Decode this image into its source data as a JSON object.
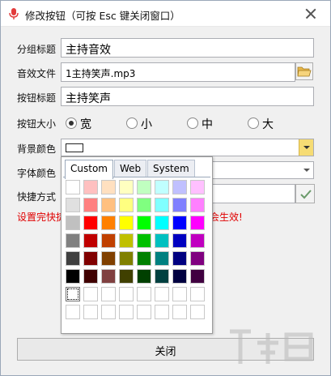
{
  "window": {
    "title": "修改按钮（可按 Esc 键关闭窗口）"
  },
  "form": {
    "group_title_label": "分组标题",
    "group_title_value": "主持音效",
    "sound_file_label": "音效文件",
    "sound_file_value": "1主持笑声.mp3",
    "button_title_label": "按钮标题",
    "button_title_value": "主持笑声",
    "button_size_label": "按钮大小",
    "size_options": [
      "宽",
      "小",
      "中",
      "大"
    ],
    "size_selected": "宽",
    "bg_color_label": "背景颜色",
    "bg_color_value": "#ffffff",
    "font_color_label": "字体颜色",
    "shortcut_label": "快捷方式",
    "warning_left": "设置完快捷",
    "warning_right": "会生效!",
    "close_button_label": "关闭"
  },
  "color_picker": {
    "tabs": [
      "Custom",
      "Web",
      "System"
    ],
    "active_tab": "Custom",
    "palette_rows": [
      [
        "#ffffff",
        "#ffc0c0",
        "#ffe0c0",
        "#ffffc0",
        "#c0ffc0",
        "#c0ffff",
        "#c0c0ff",
        "#ffc0ff"
      ],
      [
        "#e0e0e0",
        "#ff8080",
        "#ffc080",
        "#ffff80",
        "#80ff80",
        "#80ffff",
        "#8080ff",
        "#ff80ff"
      ],
      [
        "#c0c0c0",
        "#ff0000",
        "#ff8000",
        "#ffff00",
        "#00ff00",
        "#00ffff",
        "#0000ff",
        "#ff00ff"
      ],
      [
        "#808080",
        "#c00000",
        "#c04000",
        "#c0c000",
        "#00c000",
        "#00c0c0",
        "#0000c0",
        "#c000c0"
      ],
      [
        "#404040",
        "#800000",
        "#804000",
        "#808000",
        "#008000",
        "#008080",
        "#000080",
        "#800080"
      ],
      [
        "#000000",
        "#400000",
        "#804040",
        "#404000",
        "#004000",
        "#004040",
        "#000040",
        "#400040"
      ],
      [
        "#ffffff",
        "#ffffff",
        "#ffffff",
        "#ffffff",
        "#ffffff",
        "#ffffff",
        "#ffffff",
        "#ffffff"
      ],
      [
        "#ffffff",
        "#ffffff",
        "#ffffff",
        "#ffffff",
        "#ffffff",
        "#ffffff",
        "#ffffff",
        "#ffffff"
      ]
    ]
  },
  "colors": {
    "warning": "#e00000",
    "combo_arrow": "#f6dc74",
    "accent_tab_border": "#9aa8ba"
  },
  "icons": {
    "title_icon": "microphone-icon",
    "folder_icon": "folder-open-icon",
    "check_icon": "checkmark-icon",
    "close_icon": "close-icon"
  }
}
